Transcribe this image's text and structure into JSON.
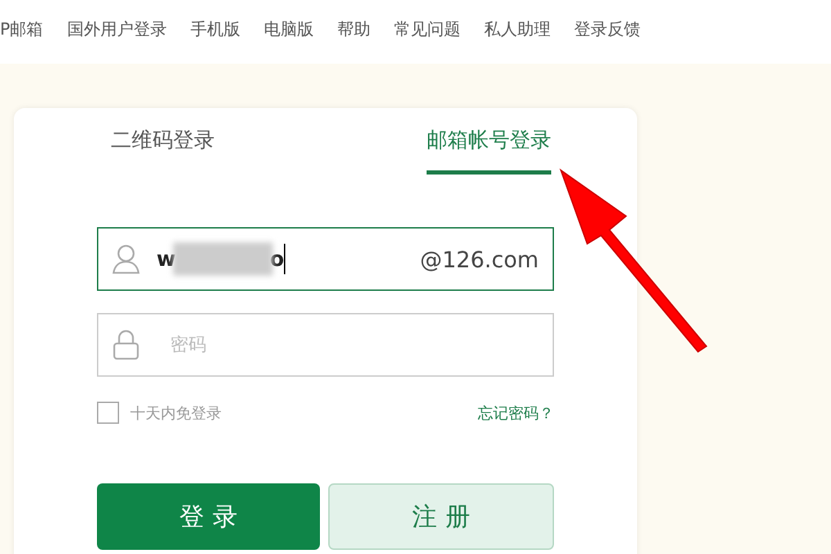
{
  "nav": [
    "P邮箱",
    "国外用户登录",
    "手机版",
    "电脑版",
    "帮助",
    "常见问题",
    "私人助理",
    "登录反馈"
  ],
  "tabs": [
    {
      "label": "二维码登录",
      "selected": false
    },
    {
      "label": "邮箱帐号登录",
      "selected": true
    }
  ],
  "username": {
    "value_start": "w",
    "value_end": "o",
    "suffix": "@126.com",
    "focused": true
  },
  "password": {
    "placeholder": "密码",
    "focused": false
  },
  "remember": {
    "label": "十天内免登录",
    "checked": false
  },
  "forgot_link": "忘记密码？",
  "buttons": [
    {
      "label": "登 录",
      "kind": "primary"
    },
    {
      "label": "注 册",
      "kind": "secondary"
    }
  ]
}
